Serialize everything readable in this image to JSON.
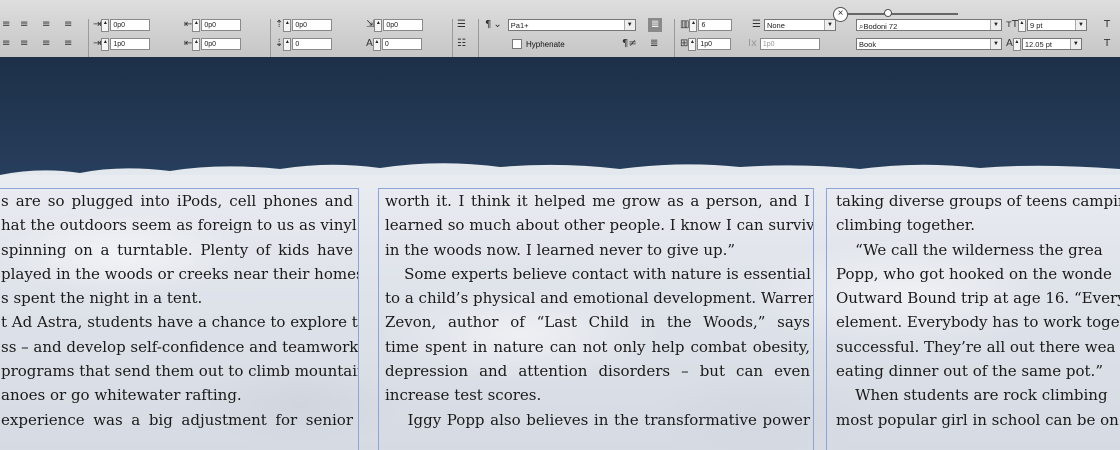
{
  "control_panel": {
    "para_spacing": {
      "left_indent": "0p0",
      "right_indent": "0p0",
      "first_indent": "1p0",
      "last_indent": "0p0",
      "space_before": "0p0",
      "space_after": "0",
      "drop_cap_lines": "0p0",
      "drop_cap_chars": "0"
    },
    "para_style": "Pa1+",
    "hyphenate_label": "Hyphenate",
    "columns": {
      "count": "6",
      "gutter": "1p0",
      "span": "1p0"
    },
    "align_to": "None",
    "font": {
      "family": "Bodoni 72",
      "style": "Book",
      "size": "9 pt",
      "leading": "12.05 pt"
    },
    "icons": {
      "close": "close-icon",
      "align": "align-icon",
      "pilcrow": "pilcrow-icon"
    }
  },
  "document": {
    "columns": [
      {
        "lines": [
          "s are so plugged into iPods, cell phones and",
          "hat the outdoors seem as foreign to us as vinyl",
          "spinning on a turntable. Plenty of kids have",
          "played in the woods or creeks near their homes,",
          "s spent the night in a tent.",
          "t Ad Astra, students have a chance to explore the",
          "ss – and develop self-confidence and teamwork –",
          "programs that send them out to climb mountains,",
          "anoes or go whitewater rafting.",
          "experience was a big adjustment for senior"
        ]
      },
      {
        "lines": [
          "worth it. I think it helped me grow as a person, and I",
          "learned so much about other people. I know I can survive",
          "in the woods now. I learned never to give up.”",
          "    Some experts believe contact with nature is essential",
          "to a child’s physical and emotional development. Warren",
          "Zevon, author of “Last Child in the Woods,” says",
          "time spent in nature can not only help combat obesity,",
          "depression and attention disorders – but can even",
          "increase test scores.",
          "    Iggy Popp also believes in the transformative power"
        ]
      },
      {
        "lines": [
          "taking diverse groups of teens campin",
          "climbing together.",
          "    “We call the wilderness the grea",
          "Popp, who got hooked on the wonde",
          "Outward Bound trip at age 16. “Every",
          "element. Everybody has to work togeth",
          "successful. They’re all out there wea",
          "eating dinner out of the same pot.”",
          "    When students are rock climbing",
          "most popular girl in school can be on t"
        ]
      }
    ]
  }
}
